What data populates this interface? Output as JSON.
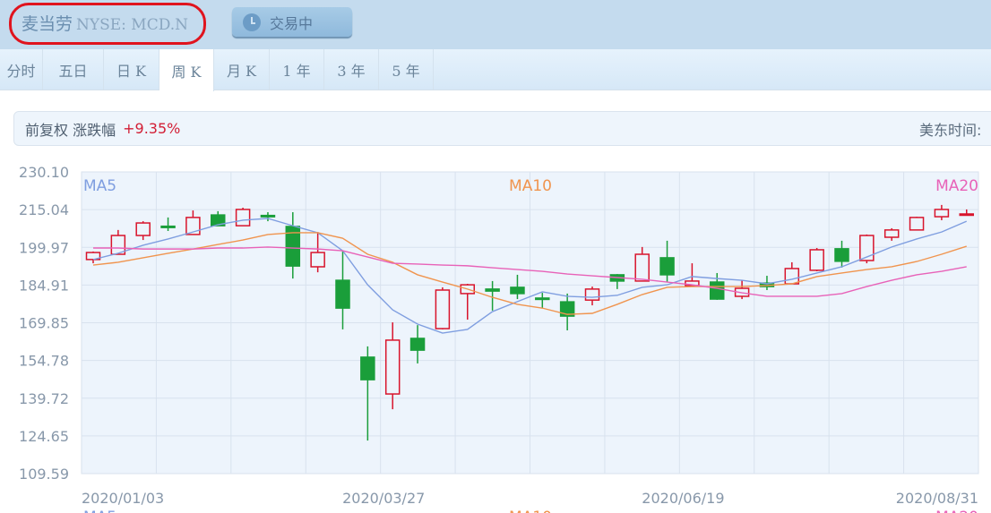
{
  "header": {
    "name": "麦当劳",
    "code": "NYSE: MCD.N",
    "status": "交易中"
  },
  "tabs": [
    {
      "label": "分时"
    },
    {
      "label": "五日"
    },
    {
      "label": "日 K"
    },
    {
      "label": "周 K",
      "active": true
    },
    {
      "label": "月 K"
    },
    {
      "label": "1 年"
    },
    {
      "label": "3 年"
    },
    {
      "label": "5 年"
    }
  ],
  "info": {
    "adjust": "前复权",
    "change_label": "涨跌幅",
    "change": "+9.35%",
    "time_label": "美东时间:"
  },
  "colors": {
    "up": "#d8142c",
    "down": "#1a9e3a",
    "ma5": "#7f9ee0",
    "ma10": "#f0944e",
    "ma20": "#e862b8",
    "grid": "#d8e2ee",
    "plot_bg": "#edf4fc",
    "axis_text": "#8898aa"
  },
  "chart_data": {
    "type": "candlestick",
    "title": "麦当劳 周K",
    "yticks": [
      "230.10",
      "215.04",
      "199.97",
      "184.91",
      "169.85",
      "154.78",
      "139.72",
      "124.65",
      "109.59"
    ],
    "ylim": [
      109.59,
      230.1
    ],
    "xlabels": [
      {
        "index": 0,
        "label": "2020/01/03"
      },
      {
        "index": 12,
        "label": "2020/03/27"
      },
      {
        "index": 24,
        "label": "2020/06/19"
      },
      {
        "index": 35,
        "label": "2020/08/31"
      }
    ],
    "legend": [
      "MA5",
      "MA10",
      "MA20"
    ],
    "grid": true,
    "ohlc": [
      [
        195.1,
        198.3,
        193.6,
        197.9
      ],
      [
        197.2,
        206.9,
        197.2,
        204.7
      ],
      [
        204.7,
        210.4,
        202.9,
        209.7
      ],
      [
        208.4,
        211.9,
        206.5,
        208.3
      ],
      [
        205.1,
        214.7,
        205.1,
        211.9
      ],
      [
        212.9,
        214.4,
        208.6,
        208.6
      ],
      [
        208.6,
        215.8,
        208.6,
        215.1
      ],
      [
        212.7,
        214.0,
        210.4,
        212.5
      ],
      [
        208.3,
        214.0,
        187.5,
        192.5
      ],
      [
        192.2,
        206.1,
        190.0,
        197.9
      ],
      [
        186.8,
        198.6,
        167.2,
        175.7
      ],
      [
        156.1,
        160.4,
        122.8,
        147.1
      ],
      [
        141.4,
        170.0,
        135.3,
        162.9
      ],
      [
        163.6,
        168.9,
        153.6,
        158.9
      ],
      [
        167.5,
        184.0,
        167.2,
        182.9
      ],
      [
        181.5,
        185.4,
        171.1,
        185.0
      ],
      [
        183.3,
        186.5,
        174.7,
        182.5
      ],
      [
        184.0,
        189.0,
        179.3,
        181.5
      ],
      [
        179.7,
        181.8,
        175.7,
        179.6
      ],
      [
        178.2,
        181.5,
        166.8,
        172.5
      ],
      [
        178.9,
        184.3,
        176.8,
        183.3
      ],
      [
        189.0,
        189.3,
        183.3,
        186.5
      ],
      [
        186.5,
        200.1,
        186.5,
        197.2
      ],
      [
        195.8,
        202.6,
        186.1,
        189.0
      ],
      [
        184.7,
        193.6,
        184.7,
        186.5
      ],
      [
        186.1,
        189.7,
        179.0,
        179.3
      ],
      [
        180.4,
        186.8,
        179.3,
        183.6
      ],
      [
        185.7,
        188.6,
        182.9,
        184.3
      ],
      [
        185.4,
        194.0,
        185.4,
        191.5
      ],
      [
        190.8,
        199.7,
        190.4,
        199.0
      ],
      [
        199.4,
        202.6,
        191.9,
        194.4
      ],
      [
        194.7,
        205.1,
        193.6,
        204.7
      ],
      [
        204.0,
        207.6,
        202.6,
        206.9
      ],
      [
        206.9,
        212.2,
        206.9,
        211.9
      ],
      [
        212.2,
        216.9,
        210.8,
        215.1
      ],
      [
        213.0,
        215.1,
        212.9,
        213.3
      ]
    ],
    "ma5": [
      195.1,
      197.6,
      200.8,
      203.3,
      206.1,
      209.0,
      210.8,
      211.5,
      208.6,
      205.8,
      198.6,
      185.0,
      175.0,
      169.3,
      165.7,
      167.2,
      174.3,
      178.3,
      182.2,
      180.4,
      180.0,
      180.8,
      184.0,
      185.0,
      188.3,
      187.5,
      186.8,
      185.4,
      187.2,
      189.7,
      192.2,
      196.1,
      200.1,
      203.3,
      206.1,
      210.4
    ],
    "ma10": [
      192.9,
      194.0,
      195.8,
      197.6,
      199.3,
      201.1,
      202.9,
      205.1,
      205.8,
      205.8,
      203.6,
      197.2,
      194.0,
      189.0,
      186.1,
      183.3,
      180.0,
      177.2,
      175.7,
      173.2,
      173.6,
      177.2,
      181.1,
      184.0,
      184.3,
      184.3,
      184.3,
      184.7,
      185.4,
      188.3,
      189.7,
      191.1,
      192.2,
      194.3,
      197.2,
      200.4
    ],
    "ma20": [
      199.7,
      199.7,
      199.3,
      199.3,
      199.3,
      199.7,
      199.7,
      200.1,
      199.7,
      199.3,
      198.6,
      196.1,
      193.6,
      193.3,
      192.9,
      192.6,
      191.8,
      191.1,
      190.4,
      189.3,
      188.6,
      187.9,
      187.2,
      186.1,
      185.0,
      183.6,
      181.8,
      180.4,
      180.4,
      180.4,
      181.5,
      184.3,
      186.8,
      189.0,
      190.4,
      192.2
    ]
  }
}
